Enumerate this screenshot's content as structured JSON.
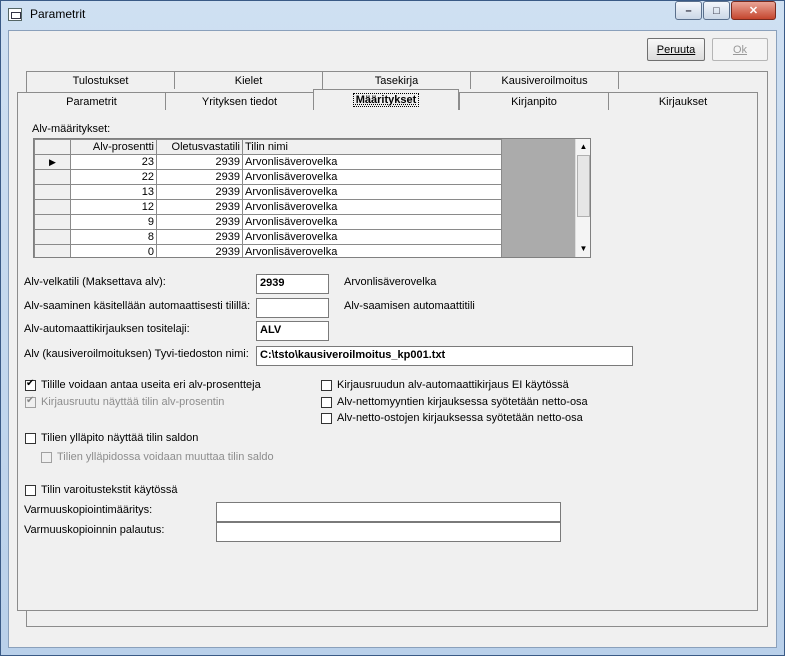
{
  "window": {
    "title": "Parametrit",
    "minimize": "–",
    "maximize": "□",
    "close": "✕"
  },
  "buttons": {
    "cancel": "Peruuta",
    "ok": "Ok"
  },
  "tabs_back": [
    "Tulostukset",
    "Kielet",
    "Tasekirja",
    "Kausiveroilmoitus"
  ],
  "tabs_front": [
    "Parametrit",
    "Yrityksen tiedot",
    "Määritykset",
    "Kirjanpito",
    "Kirjaukset"
  ],
  "alv_section_label": "Alv-määritykset:",
  "grid": {
    "headers": [
      "Alv-prosentti",
      "Oletusvastatili",
      "Tilin nimi"
    ],
    "rows": [
      [
        "23",
        "2939",
        "Arvonlisäverovelka"
      ],
      [
        "22",
        "2939",
        "Arvonlisäverovelka"
      ],
      [
        "13",
        "2939",
        "Arvonlisäverovelka"
      ],
      [
        "12",
        "2939",
        "Arvonlisäverovelka"
      ],
      [
        "9",
        "2939",
        "Arvonlisäverovelka"
      ],
      [
        "8",
        "2939",
        "Arvonlisäverovelka"
      ],
      [
        "0",
        "2939",
        "Arvonlisäverovelka"
      ]
    ],
    "current_row_marker": "▶"
  },
  "fields": {
    "alv_velkatili_label": "Alv-velkatili (Maksettava alv):",
    "alv_velkatili_value": "2939",
    "alv_velkatili_name": "Arvonlisäverovelka",
    "alv_saaminen_label": "Alv-saaminen käsitellään automaattisesti tilillä:",
    "alv_saaminen_value": "",
    "alv_saaminen_name": "Alv-saamisen automaattitili",
    "tositelaji_label": "Alv-automaattikirjauksen tositelaji:",
    "tositelaji_value": "ALV",
    "tyvi_label": "Alv (kausiveroilmoituksen) Tyvi-tiedoston nimi:",
    "tyvi_value": "C:\\tsto\\kausiveroilmoitus_kp001.txt"
  },
  "checkboxes": {
    "useita_alv": "Tilille voidaan antaa useita eri alv-prosentteja",
    "kirjausruutu_alv": "Kirjausruutu näyttää tilin alv-prosentin",
    "ei_automaatti": "Kirjausruudun alv-automaattikirjaus EI käytössä",
    "nettomyynnit": "Alv-nettomyyntien kirjauksessa syötetään netto-osa",
    "nettoostot": "Alv-netto-ostojen kirjauksessa syötetään netto-osa",
    "saldot": "Tilien ylläpito näyttää tilin saldon",
    "saldo_muutos": "Tilien ylläpidossa voidaan muuttaa tilin saldo",
    "varoitus": "Tilin varoitustekstit käytössä"
  },
  "backup": {
    "maaritys_label": "Varmuuskopiointimääritys:",
    "maaritys_value": "",
    "palautus_label": "Varmuuskopioinnin palautus:",
    "palautus_value": ""
  },
  "scrollbar": {
    "up": "▲",
    "down": "▼"
  }
}
